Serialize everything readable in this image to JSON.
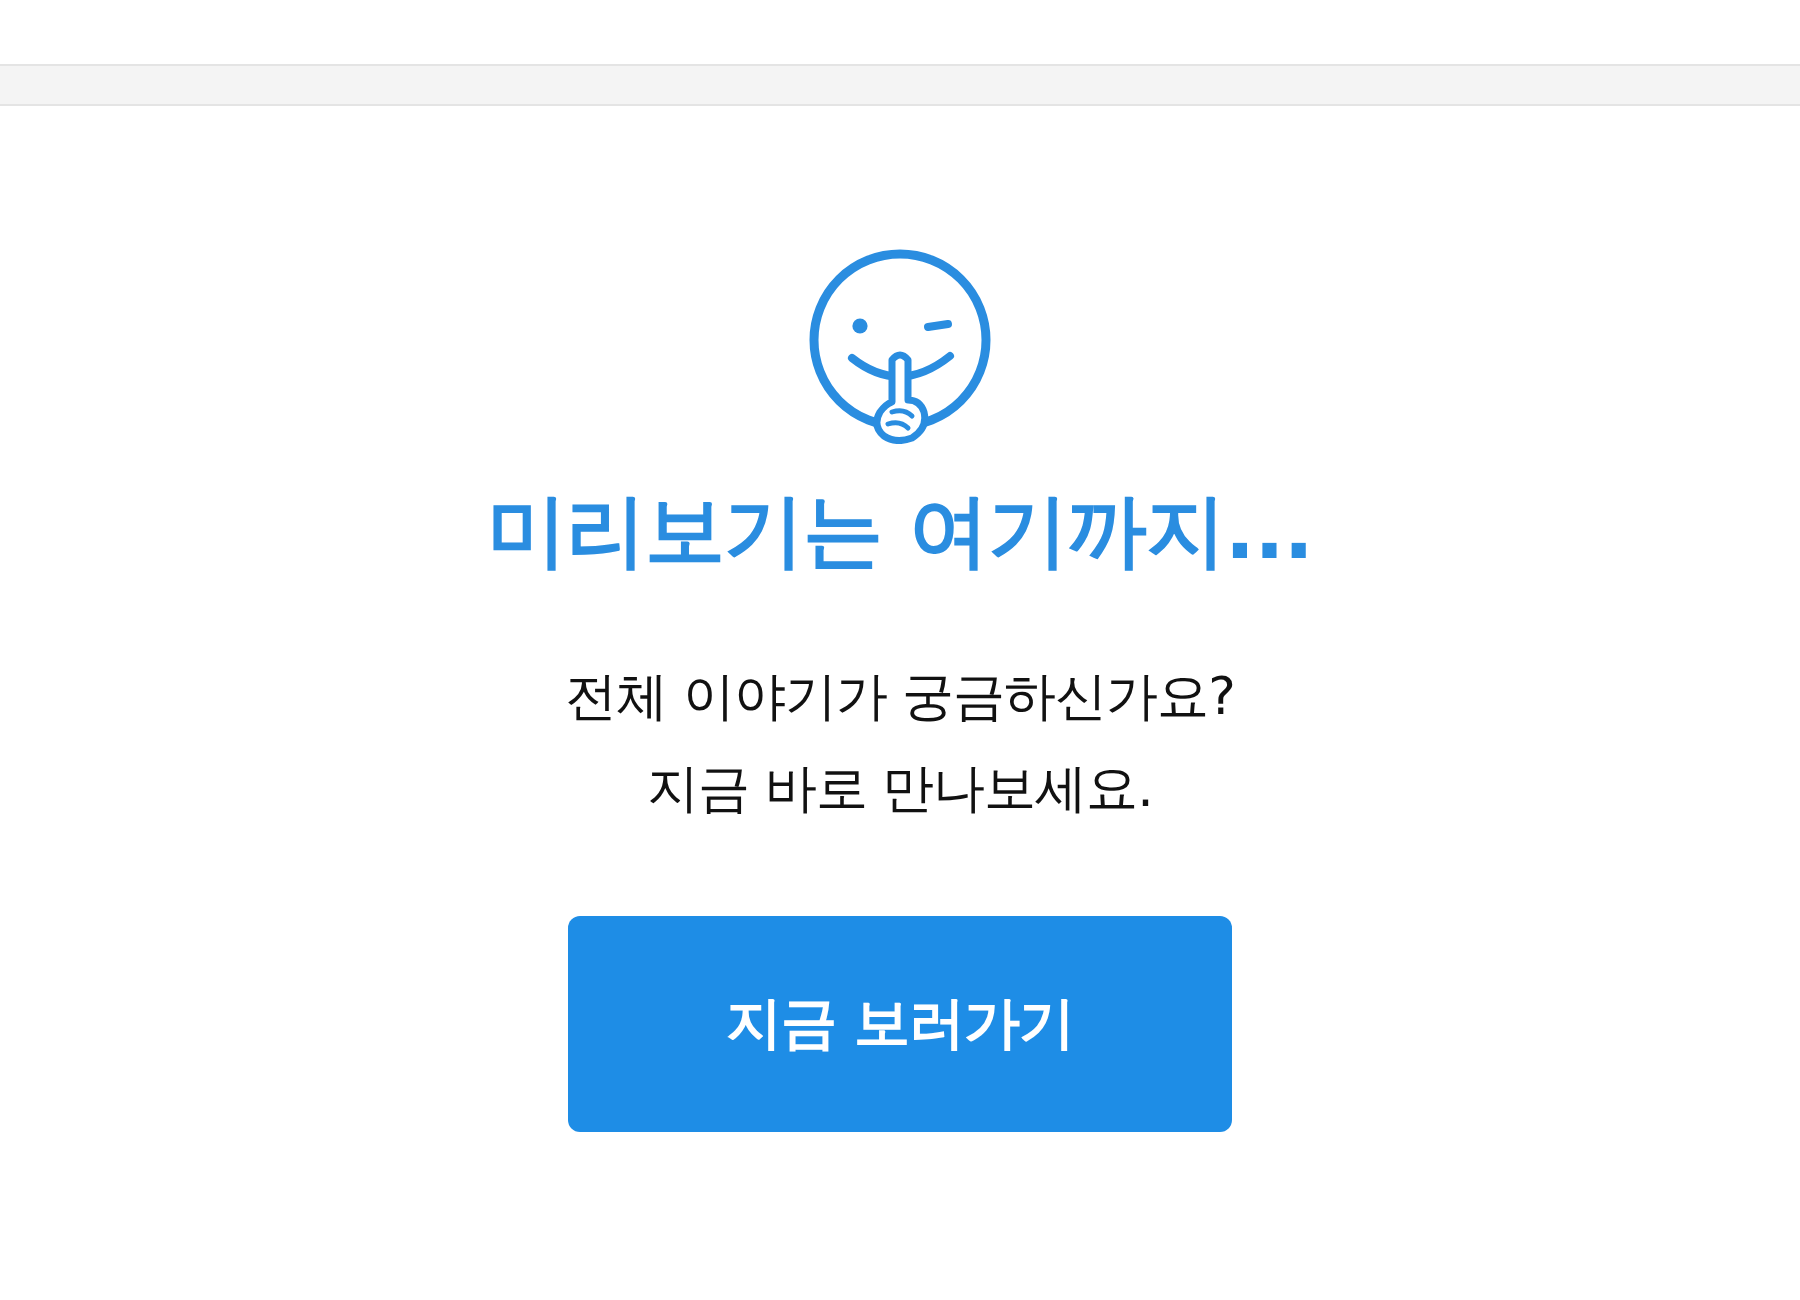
{
  "preview_end": {
    "title": "미리보기는 여기까지...",
    "message_lines": [
      "전체 이야기가 궁금하신가요?",
      "지금 바로 만나보세요."
    ],
    "button": {
      "label": "지금 보러가기"
    }
  }
}
